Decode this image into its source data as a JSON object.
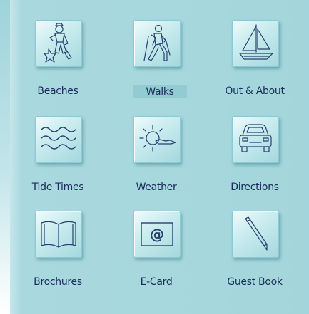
{
  "menu": {
    "items": [
      {
        "label": "Beaches",
        "icon": "beach-figure-icon"
      },
      {
        "label": "Walks",
        "icon": "hiker-icon"
      },
      {
        "label": "Out & About",
        "icon": "sailboat-icon"
      },
      {
        "label": "Tide Times",
        "icon": "waves-icon"
      },
      {
        "label": "Weather",
        "icon": "sun-cloud-icon"
      },
      {
        "label": "Directions",
        "icon": "car-icon"
      },
      {
        "label": "Brochures",
        "icon": "open-book-icon"
      },
      {
        "label": "E-Card",
        "icon": "at-sign-icon"
      },
      {
        "label": "Guest Book",
        "icon": "pen-icon"
      }
    ]
  },
  "colors": {
    "background": "#a3d6dc",
    "label_text": "#1a2c5a",
    "highlight": "#93cbd3",
    "icon_stroke": "#27406b"
  }
}
